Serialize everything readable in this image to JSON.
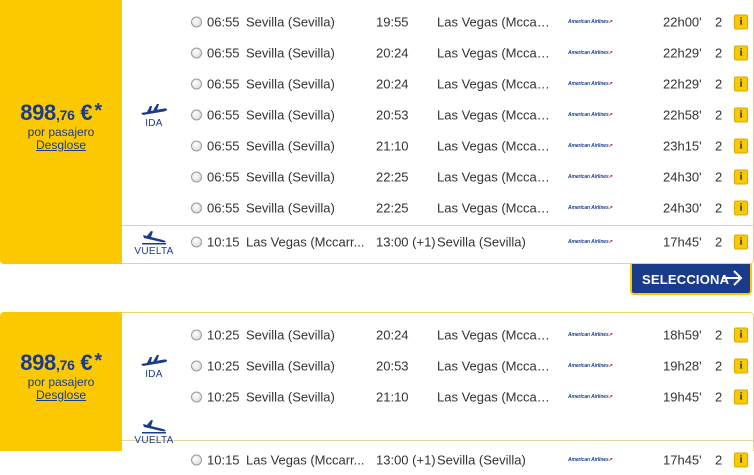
{
  "colors": {
    "accent_yellow": "#fcc900",
    "brand_blue": "#1a3a8a",
    "airline_red": "#c8102e"
  },
  "offers": [
    {
      "price": {
        "integer": "898",
        "decimal": ",76",
        "currency": "€",
        "star": "*"
      },
      "per_passenger": "por pasajero",
      "breakdown_link": "Desglose",
      "outbound_label": "IDA",
      "return_label": "VUELTA",
      "outbound": [
        {
          "dep_time": "06:55",
          "dep_city": "Sevilla (Sevilla)",
          "arr_time": "19:55",
          "arr_city": "Las Vegas (Mccarr...",
          "airline": "American Airlines",
          "duration": "22h00'",
          "stops": "2",
          "info": "i"
        },
        {
          "dep_time": "06:55",
          "dep_city": "Sevilla (Sevilla)",
          "arr_time": "20:24",
          "arr_city": "Las Vegas (Mccarr...",
          "airline": "American Airlines",
          "duration": "22h29'",
          "stops": "2",
          "info": "i"
        },
        {
          "dep_time": "06:55",
          "dep_city": "Sevilla (Sevilla)",
          "arr_time": "20:24",
          "arr_city": "Las Vegas (Mccarr...",
          "airline": "American Airlines",
          "duration": "22h29'",
          "stops": "2",
          "info": "i"
        },
        {
          "dep_time": "06:55",
          "dep_city": "Sevilla (Sevilla)",
          "arr_time": "20:53",
          "arr_city": "Las Vegas (Mccarr...",
          "airline": "American Airlines",
          "duration": "22h58'",
          "stops": "2",
          "info": "i"
        },
        {
          "dep_time": "06:55",
          "dep_city": "Sevilla (Sevilla)",
          "arr_time": "21:10",
          "arr_city": "Las Vegas (Mccarr...",
          "airline": "American Airlines",
          "duration": "23h15'",
          "stops": "2",
          "info": "i"
        },
        {
          "dep_time": "06:55",
          "dep_city": "Sevilla (Sevilla)",
          "arr_time": "22:25",
          "arr_city": "Las Vegas (Mccarr...",
          "airline": "American Airlines",
          "duration": "24h30'",
          "stops": "2",
          "info": "i"
        },
        {
          "dep_time": "06:55",
          "dep_city": "Sevilla (Sevilla)",
          "arr_time": "22:25",
          "arr_city": "Las Vegas (Mccarr...",
          "airline": "American Airlines",
          "duration": "24h30'",
          "stops": "2",
          "info": "i"
        }
      ],
      "return": [
        {
          "dep_time": "10:15",
          "dep_city": "Las Vegas (Mccarr...",
          "arr_time": "13:00 (+1)",
          "arr_city": "Sevilla (Sevilla)",
          "airline": "American Airlines",
          "duration": "17h45'",
          "stops": "2",
          "info": "i"
        }
      ],
      "select_label": "SELECCIONA"
    },
    {
      "price": {
        "integer": "898",
        "decimal": ",76",
        "currency": "€",
        "star": "*"
      },
      "per_passenger": "por pasajero",
      "breakdown_link": "Desglose",
      "outbound_label": "IDA",
      "return_label": "VUELTA",
      "outbound": [
        {
          "dep_time": "10:25",
          "dep_city": "Sevilla (Sevilla)",
          "arr_time": "20:24",
          "arr_city": "Las Vegas (Mccarr...",
          "airline": "American Airlines",
          "duration": "18h59'",
          "stops": "2",
          "info": "i"
        },
        {
          "dep_time": "10:25",
          "dep_city": "Sevilla (Sevilla)",
          "arr_time": "20:53",
          "arr_city": "Las Vegas (Mccarr...",
          "airline": "American Airlines",
          "duration": "19h28'",
          "stops": "2",
          "info": "i"
        },
        {
          "dep_time": "10:25",
          "dep_city": "Sevilla (Sevilla)",
          "arr_time": "21:10",
          "arr_city": "Las Vegas (Mccarr...",
          "airline": "American Airlines",
          "duration": "19h45'",
          "stops": "2",
          "info": "i"
        }
      ],
      "return": [
        {
          "dep_time": "10:15",
          "dep_city": "Las Vegas (Mccarr...",
          "arr_time": "13:00 (+1)",
          "arr_city": "Sevilla (Sevilla)",
          "airline": "American Airlines",
          "duration": "17h45'",
          "stops": "2",
          "info": "i"
        }
      ]
    }
  ]
}
